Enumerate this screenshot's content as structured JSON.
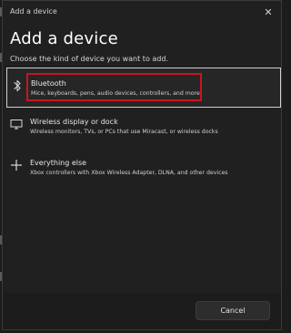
{
  "dialog": {
    "window_title": "Add a device",
    "heading": "Add a device",
    "subheading": "Choose the kind of device you want to add.",
    "close_glyph": "✕"
  },
  "options": [
    {
      "icon": "bluetooth-icon",
      "label": "Bluetooth",
      "description": "Mice, keyboards, pens, audio devices, controllers, and more",
      "selected": true
    },
    {
      "icon": "monitor-icon",
      "label": "Wireless display or dock",
      "description": "Wireless monitors, TVs, or PCs that use Miracast, or wireless docks",
      "selected": false
    },
    {
      "icon": "plus-icon",
      "label": "Everything else",
      "description": "Xbox controllers with Xbox Wireless Adapter, DLNA, and other devices",
      "selected": false
    }
  ],
  "footer": {
    "cancel_label": "Cancel"
  },
  "colors": {
    "highlight_box": "#c8161d",
    "dialog_bg": "#202020",
    "selected_border": "#cfcfcf"
  }
}
